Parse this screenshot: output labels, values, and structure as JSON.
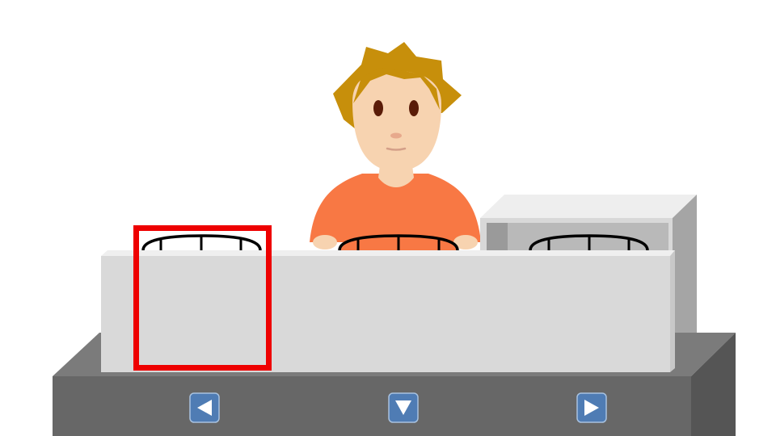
{
  "scene": {
    "character": "boy-with-orange-shirt",
    "colors": {
      "background": "#ffffff",
      "hair": "#c78f0b",
      "skin": "#f7d3b0",
      "shirt": "#f87844",
      "eye": "#5a1c08",
      "counter_front": "#d9d9d9",
      "counter_top": "#efefef",
      "box_top": "#eeeeee",
      "box_side": "#a5a5a5",
      "box_inner": "#b9b9b9",
      "floor_top": "#7b7b7b",
      "floor_front": "#676767",
      "floor_side": "#555555",
      "selection": "#ee0000",
      "button_face": "#4f7cb4",
      "button_arrow": "#ffffff"
    }
  },
  "baskets": [
    {
      "id": "left",
      "selected": true
    },
    {
      "id": "center",
      "selected": false
    },
    {
      "id": "right",
      "selected": false
    }
  ],
  "controls": {
    "left_icon": "arrow-left-icon",
    "down_icon": "arrow-down-icon",
    "right_icon": "arrow-right-icon"
  }
}
